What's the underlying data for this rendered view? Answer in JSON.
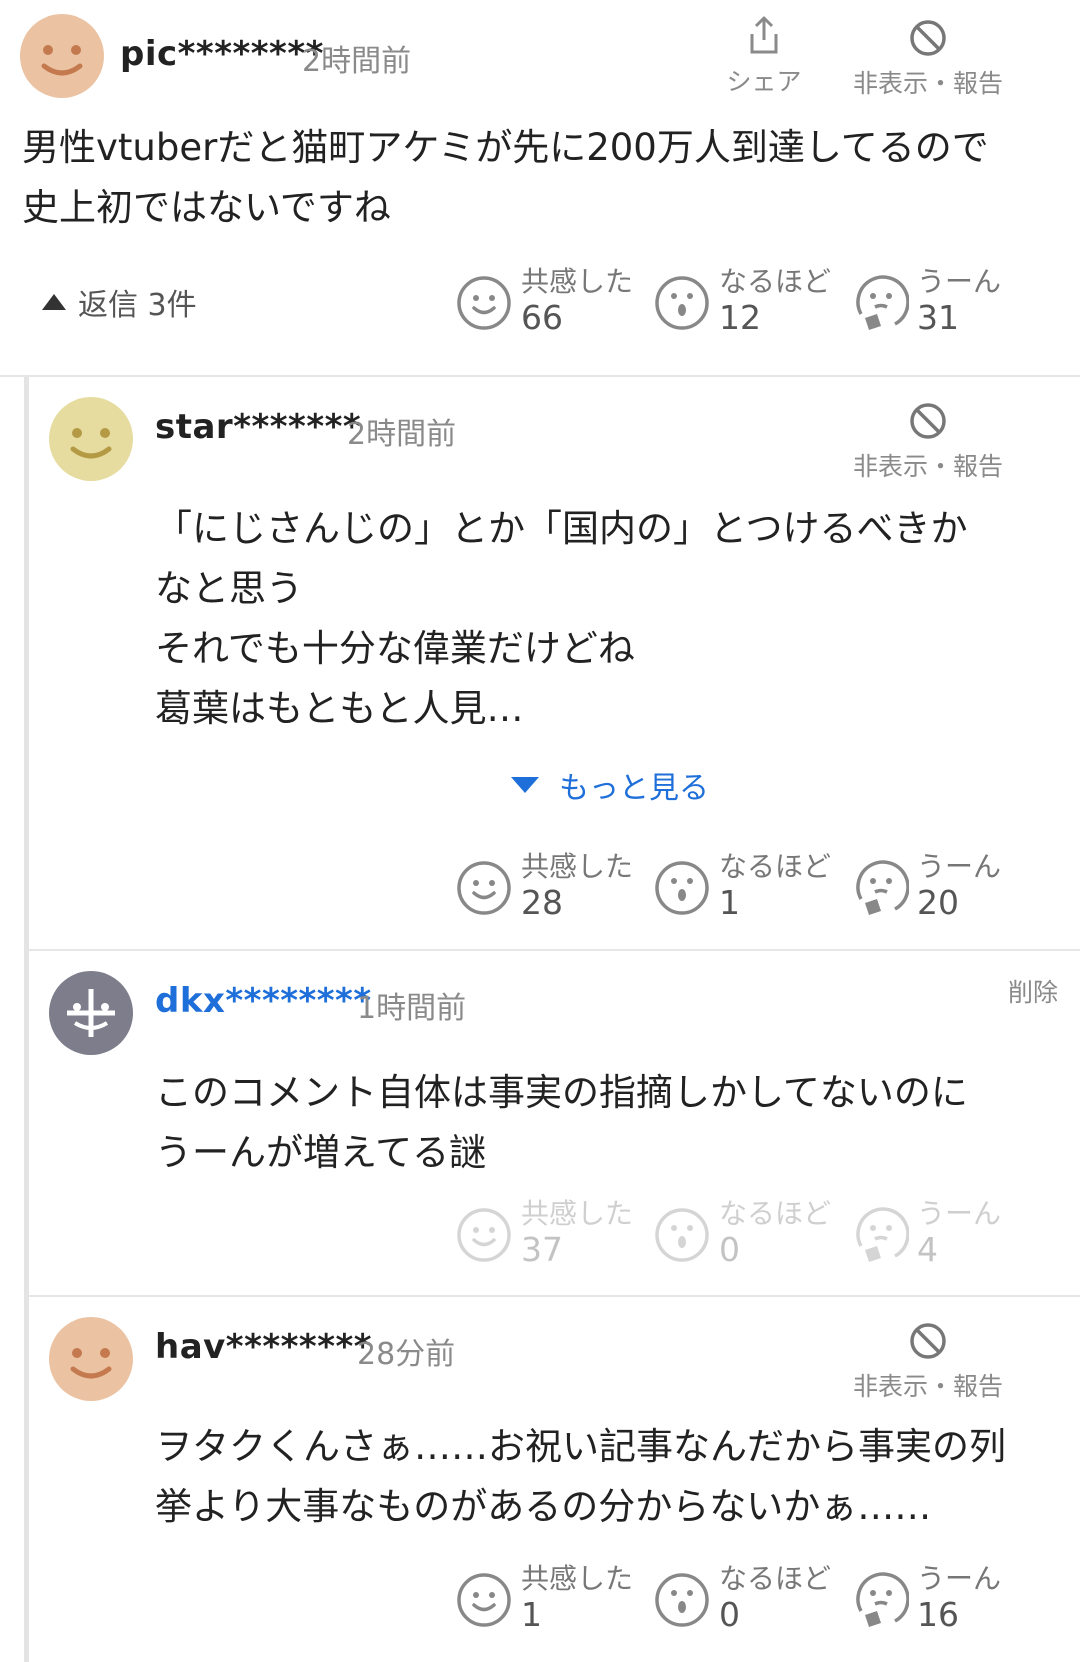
{
  "main_comment": {
    "username": "pic********",
    "time": "2時間前",
    "share_label": "シェア",
    "hide_report_label": "非表示・報告",
    "text_lines": [
      "男性vtuberだと猫町アケミが先に200万人到達してるので",
      "史上初ではないですね"
    ],
    "replies_toggle": "返信 3件",
    "reactions": {
      "agree": {
        "label": "共感した",
        "count": "66"
      },
      "naruhodo": {
        "label": "なるほど",
        "count": "12"
      },
      "hmm": {
        "label": "うーん",
        "count": "31"
      }
    },
    "avatar_color": "#ebc3a3"
  },
  "replies": [
    {
      "username": "star*******",
      "time": "2時間前",
      "hide_report_label": "非表示・報告",
      "text_lines": [
        "「にじさんじの」とか「国内の」とつけるべきか",
        "なと思う",
        "それでも十分な偉業だけどね",
        "葛葉はもともと人見…"
      ],
      "more_label": "もっと見る",
      "reactions": {
        "agree": {
          "label": "共感した",
          "count": "28"
        },
        "naruhodo": {
          "label": "なるほど",
          "count": "1"
        },
        "hmm": {
          "label": "うーん",
          "count": "20"
        }
      },
      "avatar_color": "#e6dc9f"
    },
    {
      "username": "dkx********",
      "time": "1時間前",
      "delete_label": "削除",
      "text_lines": [
        "このコメント自体は事実の指摘しかしてないのに",
        "うーんが増えてる謎"
      ],
      "reactions": {
        "agree": {
          "label": "共感した",
          "count": "37"
        },
        "naruhodo": {
          "label": "なるほど",
          "count": "0"
        },
        "hmm": {
          "label": "うーん",
          "count": "4"
        }
      },
      "avatar_color": "#7d7d8c",
      "username_color": "#1e6fd9"
    },
    {
      "username": "hav********",
      "time": "28分前",
      "hide_report_label": "非表示・報告",
      "text_lines": [
        "ヲタクくんさぁ……お祝い記事なんだから事実の列",
        "挙より大事なものがあるの分からないかぁ……"
      ],
      "reactions": {
        "agree": {
          "label": "共感した",
          "count": "1"
        },
        "naruhodo": {
          "label": "なるほど",
          "count": "0"
        },
        "hmm": {
          "label": "うーん",
          "count": "16"
        }
      },
      "avatar_color": "#ebc3a3"
    }
  ],
  "icons": {
    "share": "share-icon",
    "hide": "prohibit-icon",
    "agree_face": "smile-face-icon",
    "naruhodo_face": "surprised-face-icon",
    "hmm_face": "thinking-face-icon"
  },
  "colors": {
    "link_blue": "#1e6fd9",
    "muted_text": "#8a8a8a",
    "divider": "#e6e6e6"
  }
}
